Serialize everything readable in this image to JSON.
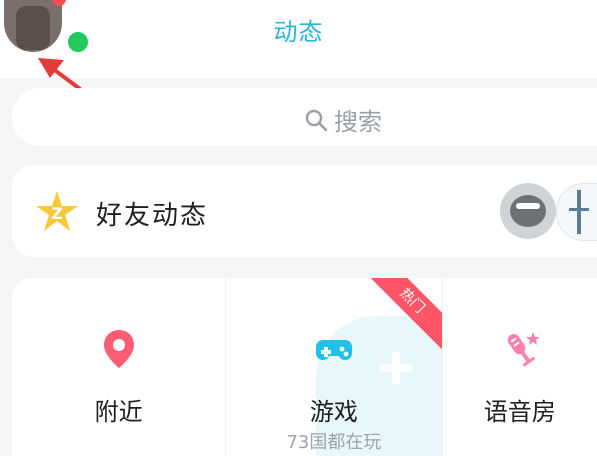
{
  "header": {
    "title": "动态"
  },
  "search": {
    "placeholder": "搜索"
  },
  "friends": {
    "title": "好友动态"
  },
  "features": [
    {
      "label": "附近",
      "sub": ""
    },
    {
      "label": "游戏",
      "sub": "73国都在玩",
      "ribbon": "热门"
    },
    {
      "label": "语音房",
      "sub": ""
    }
  ],
  "colors": {
    "accent": "#27b6d6",
    "online": "#22c95d",
    "nearby": "#ff5b73",
    "games": "#1fc2e6",
    "voice": "#ff7fb0",
    "ribbon": "#ff5567",
    "star": "#f7c836"
  },
  "icons": {
    "avatar": "user-avatar",
    "online": "online-status-dot",
    "search": "search-icon",
    "friends": "qq-zone-star-icon",
    "nearby": "location-pin-icon",
    "games": "gamepad-icon",
    "voice": "microphone-icon"
  }
}
